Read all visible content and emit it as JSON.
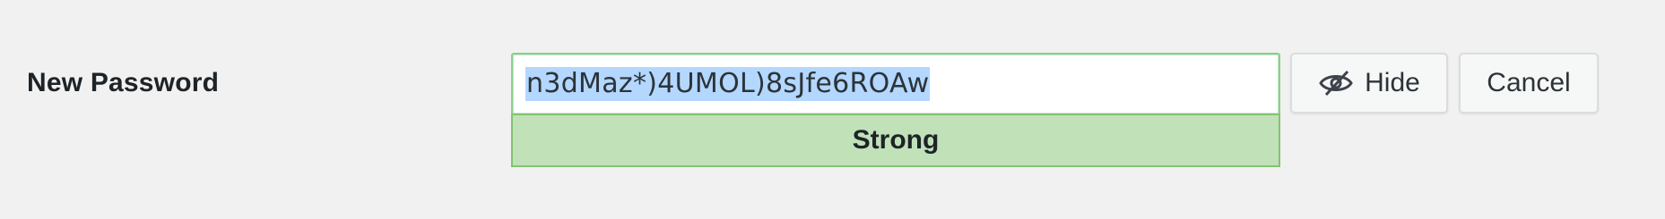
{
  "form": {
    "label": "New Password",
    "password_value": "n3dMaz*)4UMOL)8sJfe6ROAw",
    "strength_text": "Strong",
    "hide_button_label": "Hide",
    "cancel_button_label": "Cancel",
    "hide_icon": "eye-slash-icon"
  },
  "colors": {
    "background": "#f1f1f1",
    "selection": "#b3d7ff",
    "strength_fill": "#c1e1b9",
    "strength_border": "#83c373",
    "input_border": "#8ad08a"
  }
}
